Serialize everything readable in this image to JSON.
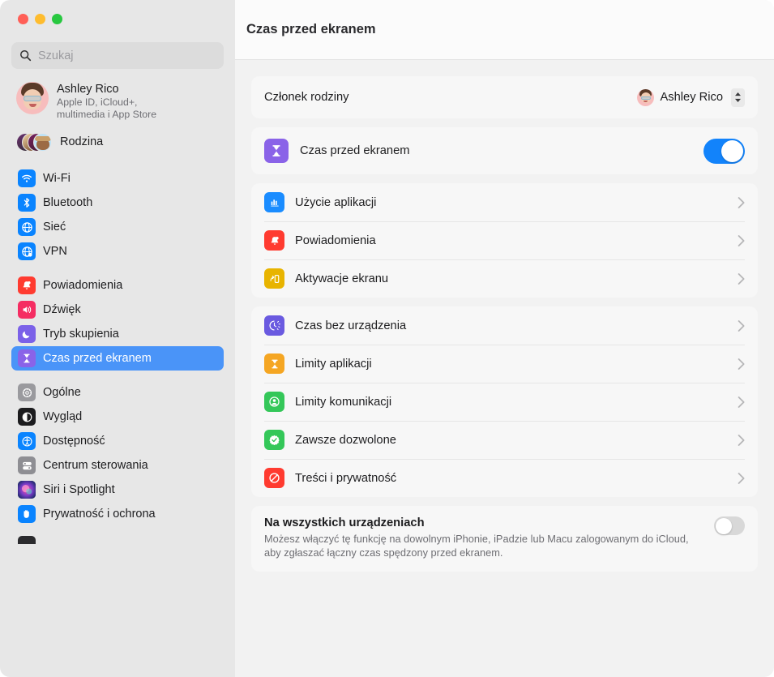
{
  "window": {
    "controls": [
      "close",
      "minimize",
      "maximize"
    ]
  },
  "search": {
    "placeholder": "Szukaj",
    "value": "",
    "icon": "search-icon"
  },
  "account": {
    "name": "Ashley Rico",
    "subtitle_line1": "Apple ID, iCloud+,",
    "subtitle_line2": "multimedia i App Store",
    "family_label": "Rodzina"
  },
  "sidebar": {
    "groups": [
      {
        "items": [
          {
            "label": "Wi-Fi",
            "icon": "wifi-icon",
            "color": "#0a84ff",
            "selected": false
          },
          {
            "label": "Bluetooth",
            "icon": "bluetooth-icon",
            "color": "#0a84ff",
            "selected": false
          },
          {
            "label": "Sieć",
            "icon": "globe-icon",
            "color": "#0a84ff",
            "selected": false
          },
          {
            "label": "VPN",
            "icon": "vpn-globe-icon",
            "color": "#0a84ff",
            "selected": false
          }
        ]
      },
      {
        "items": [
          {
            "label": "Powiadomienia",
            "icon": "bell-icon",
            "color": "#ff3b30",
            "selected": false
          },
          {
            "label": "Dźwięk",
            "icon": "speaker-icon",
            "color": "#f52d62",
            "selected": false
          },
          {
            "label": "Tryb skupienia",
            "icon": "moon-icon",
            "color": "#7b61e8",
            "selected": false
          },
          {
            "label": "Czas przed ekranem",
            "icon": "hourglass-icon",
            "color": "#8a63e8",
            "selected": true
          }
        ]
      },
      {
        "items": [
          {
            "label": "Ogólne",
            "icon": "gear-icon",
            "color": "#9a9a9e",
            "selected": false
          },
          {
            "label": "Wygląd",
            "icon": "appearance-icon",
            "color": "#1c1c1e",
            "selected": false
          },
          {
            "label": "Dostępność",
            "icon": "accessibility-icon",
            "color": "#0a84ff",
            "selected": false
          },
          {
            "label": "Centrum sterowania",
            "icon": "control-center-icon",
            "color": "#8e8e93",
            "selected": false
          },
          {
            "label": "Siri i Spotlight",
            "icon": "siri-icon",
            "color": "#3a2a4a",
            "selected": false
          },
          {
            "label": "Prywatność i ochrona",
            "icon": "hand-icon",
            "color": "#0a84ff",
            "selected": false
          }
        ]
      }
    ]
  },
  "header": {
    "title": "Czas przed ekranem"
  },
  "main": {
    "member_row": {
      "label": "Członek rodziny",
      "value": "Ashley Rico",
      "stepper_icon": "chevron-updown-icon"
    },
    "screen_time_row": {
      "label": "Czas przed ekranem",
      "icon": "hourglass-icon",
      "icon_color": "#8a63e8",
      "enabled": true
    },
    "group_usage": [
      {
        "label": "Użycie aplikacji",
        "icon": "bar-chart-icon",
        "color": "#1a8cff"
      },
      {
        "label": "Powiadomienia",
        "icon": "bell-icon",
        "color": "#ff3b30"
      },
      {
        "label": "Aktywacje ekranu",
        "icon": "pickups-icon",
        "color": "#e8b400"
      }
    ],
    "group_limits": [
      {
        "label": "Czas bez urządzenia",
        "icon": "downtime-icon",
        "color": "#6a5ae0"
      },
      {
        "label": "Limity aplikacji",
        "icon": "hourglass-icon",
        "color": "#f5a623"
      },
      {
        "label": "Limity komunikacji",
        "icon": "person-circle-icon",
        "color": "#34c759"
      },
      {
        "label": "Zawsze dozwolone",
        "icon": "check-badge-icon",
        "color": "#34c759"
      },
      {
        "label": "Treści i prywatność",
        "icon": "prohibit-icon",
        "color": "#ff3b30"
      }
    ],
    "all_devices": {
      "title": "Na wszystkich urządzeniach",
      "description": "Możesz włączyć tę funkcję na dowolnym iPhonie, iPadzie lub Macu zalogowanym do iCloud, aby zgłaszać łączny czas spędzony przed ekranem.",
      "enabled": false
    }
  },
  "colors": {
    "accent": "#4a94f8",
    "toggle_on": "#1283fb",
    "toggle_off": "#d8d8d8",
    "sidebar_bg": "#e7e7e7",
    "main_bg": "#f2f2f2",
    "card_bg": "#f7f7f7"
  }
}
